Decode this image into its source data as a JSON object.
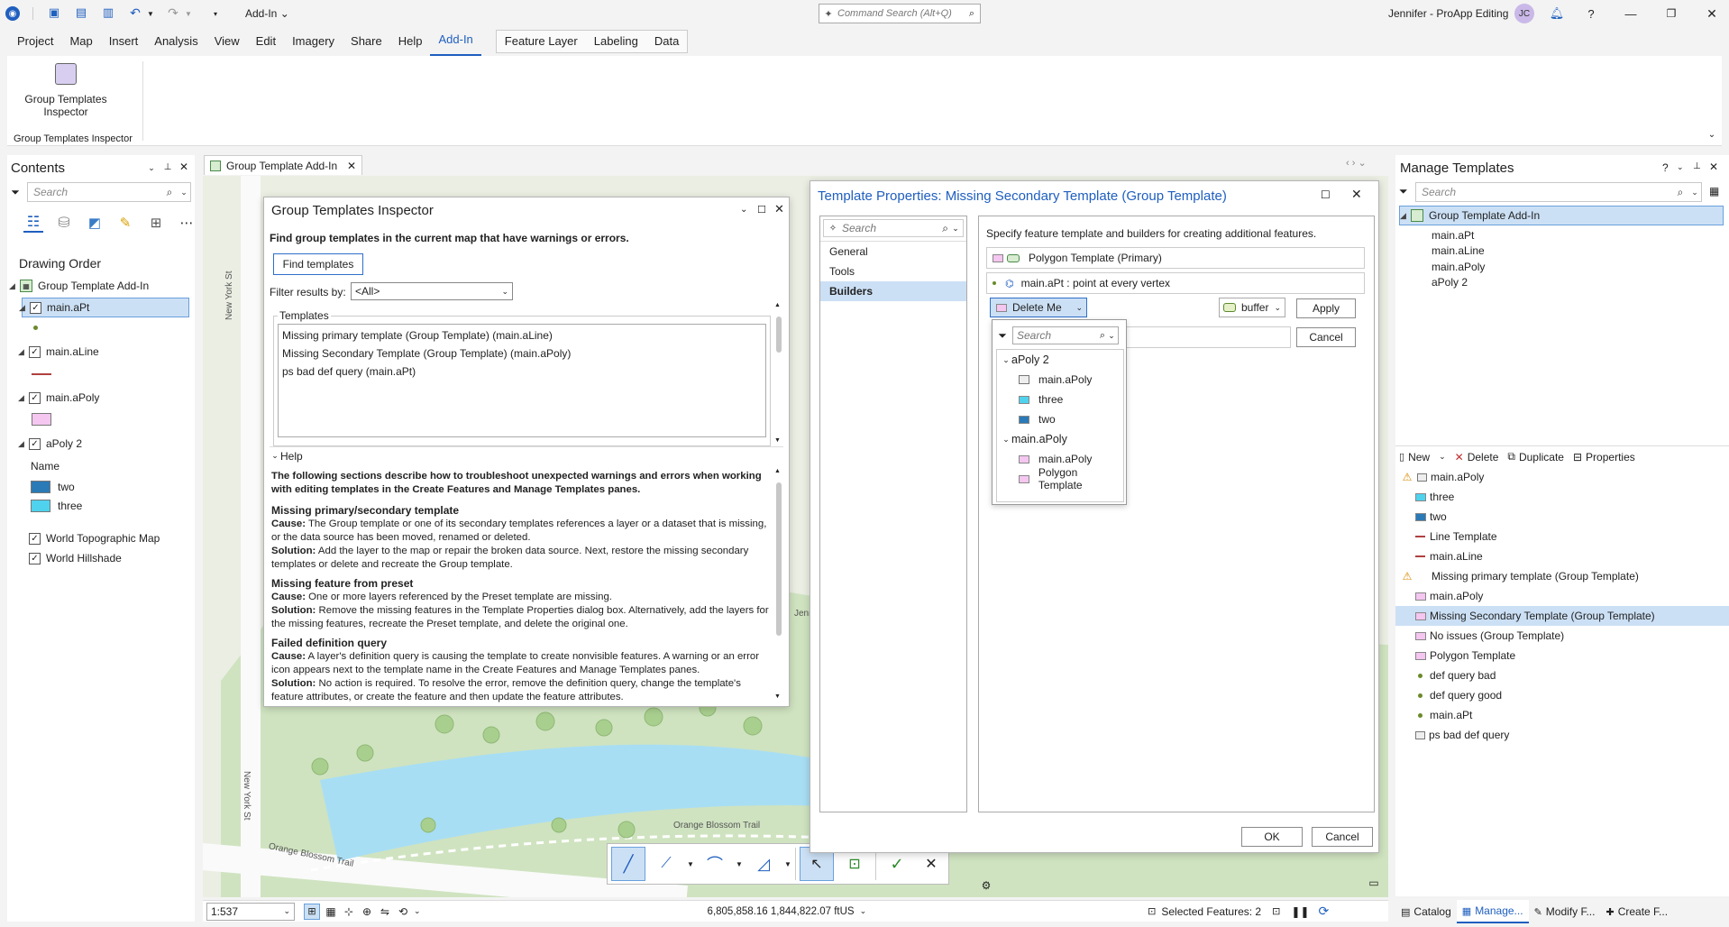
{
  "titlebar": {
    "addin_dropdown": "Add-In",
    "command_search": "Command Search (Alt+Q)",
    "user": "Jennifer - ProApp Editing",
    "initials": "JC"
  },
  "ribbon_tabs": [
    "Project",
    "Map",
    "Insert",
    "Analysis",
    "View",
    "Edit",
    "Imagery",
    "Share",
    "Help",
    "Add-In"
  ],
  "ribbon_context_tabs": [
    "Feature Layer",
    "Labeling",
    "Data"
  ],
  "ribbon": {
    "button_label_line1": "Group Templates",
    "button_label_line2": "Inspector",
    "group_label": "Group Templates Inspector"
  },
  "contents": {
    "title": "Contents",
    "search_placeholder": "Search",
    "drawing_order": "Drawing Order",
    "root": "Group Template Add-In",
    "layers": {
      "pt": "main.aPt",
      "line": "main.aLine",
      "poly": "main.aPoly",
      "apoly2": "aPoly 2",
      "name_header": "Name",
      "two": "two",
      "three": "three",
      "topo": "World Topographic Map",
      "hillshade": "World Hillshade"
    }
  },
  "map_tab": {
    "label": "Group Template Add-In"
  },
  "map_labels": {
    "ny1": "New York St",
    "ny2": "New York St",
    "obt1": "Orange Blossom Trail",
    "obt2": "Orange Blossom Trail",
    "jenn": "Jenn"
  },
  "inspector": {
    "title": "Group Templates Inspector",
    "description": "Find group templates in the current map that have warnings or errors.",
    "find_button": "Find templates",
    "filter_label": "Filter results by:",
    "filter_value": "<All>",
    "templates_label": "Templates",
    "templates": [
      "Missing primary template (Group Template) (main.aLine)",
      "Missing Secondary Template (Group Template) (main.aPoly)",
      "ps bad def query (main.aPt)"
    ],
    "help_label": "Help",
    "help_intro": "The following sections describe how to troubleshoot unexpected warnings and errors when working with editing templates in the Create Features and Manage Templates panes.",
    "sections": [
      {
        "heading": "Missing primary/secondary template",
        "cause_label": "Cause:",
        "cause": "The Group template or one of its secondary templates references a layer or a dataset that is missing, or the data source has been moved, renamed or deleted.",
        "solution_label": "Solution:",
        "solution": "Add the layer to the map or repair the broken data source. Next, restore the missing secondary templates or delete and recreate the Group template."
      },
      {
        "heading": "Missing feature from preset",
        "cause_label": "Cause:",
        "cause": "One or more layers referenced by the Preset template are missing.",
        "solution_label": "Solution:",
        "solution": "Remove the missing features in the Template Properties dialog box. Alternatively, add the layers for the missing features, recreate the Preset template, and delete the original one."
      },
      {
        "heading": "Failed definition query",
        "cause_label": "Cause:",
        "cause": "A layer's definition query is causing the template to create nonvisible features. A warning or an error icon appears next to the template name in the Create Features and Manage Templates panes.",
        "solution_label": "Solution:",
        "solution": "No action is required. To resolve the error, remove the definition query, change the template's feature attributes, or create the feature and then update the feature attributes."
      }
    ]
  },
  "template_props": {
    "title": "Template Properties: Missing Secondary Template (Group Template)",
    "search_placeholder": "Search",
    "nav": [
      "General",
      "Tools",
      "Builders"
    ],
    "description": "Specify feature template and builders for creating additional features.",
    "primary": "Polygon Template (Primary)",
    "vertex_row": "main.aPt : point at every vertex",
    "selected_template": "Delete Me",
    "builder": "buffer",
    "apply": "Apply",
    "cancel_small": "Cancel",
    "ok": "OK",
    "cancel": "Cancel",
    "dropdown": {
      "search_placeholder": "Search",
      "group1": "aPoly 2",
      "group1_items": [
        "main.aPoly",
        "three",
        "two"
      ],
      "group2": "main.aPoly",
      "group2_items": [
        "main.aPoly",
        "Polygon Template"
      ]
    }
  },
  "manage": {
    "title": "Manage Templates",
    "search_placeholder": "Search",
    "root": "Group Template Add-In",
    "tree_items": [
      "main.aPt",
      "main.aLine",
      "main.aPoly",
      "aPoly 2"
    ],
    "toolbar": {
      "new": "New",
      "delete": "Delete",
      "duplicate": "Duplicate",
      "properties": "Properties"
    },
    "list": [
      "main.aPoly",
      "three",
      "two",
      "Line Template",
      "main.aLine",
      "Missing primary template (Group Template)",
      "main.aPoly",
      "Missing Secondary Template (Group Template)",
      "No issues (Group Template)",
      "Polygon Template",
      "def query bad",
      "def query good",
      "main.aPt",
      "ps bad def query"
    ]
  },
  "statusbar": {
    "scale": "1:537",
    "coords": "6,805,858.16 1,844,822.07 ftUS",
    "selected": "Selected Features: 2"
  },
  "bottom_tabs": [
    "Catalog",
    "Manage...",
    "Modify F...",
    "Create F..."
  ],
  "colors": {
    "accent": "#1f5fbf",
    "selection": "#cce0f5",
    "poly_pink": "#f4c6f0",
    "cyan": "#4fd2ee",
    "blue": "#2a7ab8",
    "line_red": "#b04040"
  }
}
